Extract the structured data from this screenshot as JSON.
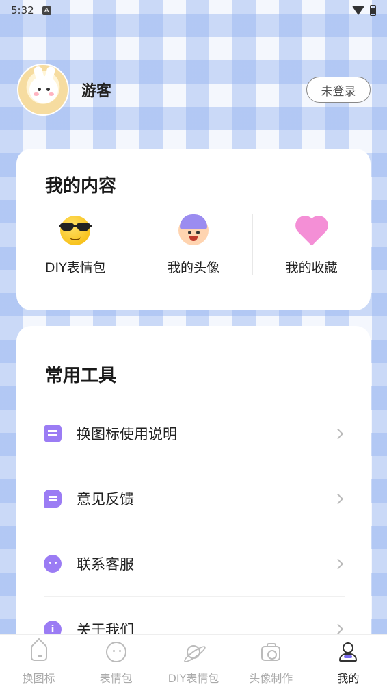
{
  "status_bar": {
    "time": "5:32",
    "a_label": "A"
  },
  "profile": {
    "username": "游客",
    "login_button": "未登录"
  },
  "my_content": {
    "title": "我的内容",
    "items": [
      {
        "label": "DIY表情包",
        "icon": "sunglasses-emoji-icon"
      },
      {
        "label": "我的头像",
        "icon": "avatar-face-icon"
      },
      {
        "label": "我的收藏",
        "icon": "heart-icon"
      }
    ]
  },
  "tools": {
    "title": "常用工具",
    "items": [
      {
        "label": "换图标使用说明",
        "icon": "document-icon"
      },
      {
        "label": "意见反馈",
        "icon": "chat-icon"
      },
      {
        "label": "联系客服",
        "icon": "face-icon"
      },
      {
        "label": "关于我们",
        "icon": "info-icon"
      }
    ]
  },
  "bottom_nav": {
    "items": [
      {
        "label": "换图标",
        "icon": "home-icon",
        "active": false
      },
      {
        "label": "表情包",
        "icon": "face-icon",
        "active": false
      },
      {
        "label": "DIY表情包",
        "icon": "planet-icon",
        "active": false
      },
      {
        "label": "头像制作",
        "icon": "camera-icon",
        "active": false
      },
      {
        "label": "我的",
        "icon": "user-icon",
        "active": true
      }
    ]
  },
  "colors": {
    "accent": "#9b7cf4",
    "plaid": "#96b4f0",
    "card": "#ffffff"
  }
}
